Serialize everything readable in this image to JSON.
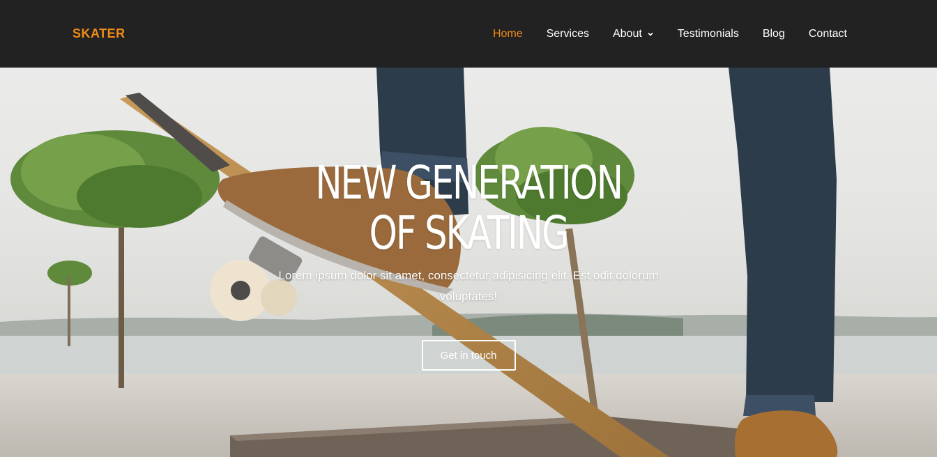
{
  "brand": {
    "name": "SKATER",
    "color": "#f28c18"
  },
  "nav": {
    "items": [
      {
        "label": "Home",
        "active": true
      },
      {
        "label": "Services",
        "active": false
      },
      {
        "label": "About",
        "active": false,
        "dropdown": true
      },
      {
        "label": "Testimonials",
        "active": false
      },
      {
        "label": "Blog",
        "active": false
      },
      {
        "label": "Contact",
        "active": false
      }
    ],
    "dropdown_icon": "chevron-down-icon"
  },
  "hero": {
    "title": "NEW GENERATION OF SKATING",
    "subtitle": "Lorem ipsum dolor sit amet, consectetur adipisicing elit. Est odit dolorum voluptates!",
    "cta_label": "Get in touch",
    "image_subject": "skateboarder-photo"
  }
}
